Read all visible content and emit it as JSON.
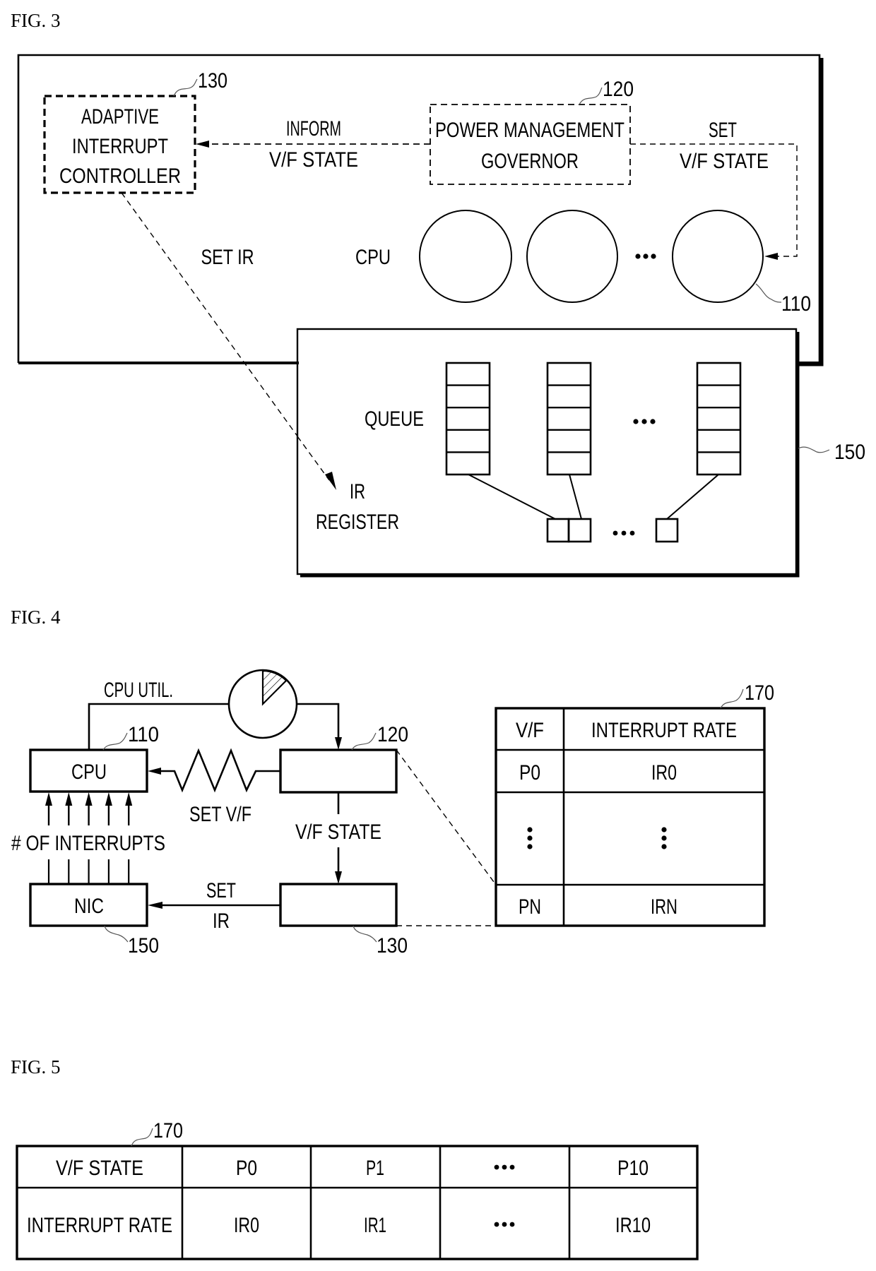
{
  "figures": {
    "fig3": {
      "title": "FIG. 3",
      "adaptive_controller": {
        "lines": [
          "ADAPTIVE",
          "INTERRUPT",
          "CONTROLLER"
        ],
        "ref": "130"
      },
      "governor": {
        "lines": [
          "POWER MANAGEMENT",
          "GOVERNOR"
        ],
        "ref": "120"
      },
      "inform_arrow": {
        "lines": [
          "INFORM",
          "V/F STATE"
        ]
      },
      "set_vf_arrow": {
        "lines": [
          "SET",
          "V/F STATE"
        ]
      },
      "set_ir_label": "SET IR",
      "cpu_label": "CPU",
      "cpu_ellipsis": "•••",
      "cpu_ref": "110",
      "nic": {
        "ref": "150",
        "queue_label": "QUEUE",
        "queue_ellipsis": "•••",
        "register_ellipsis": "•••",
        "ir_register_lines": [
          "IR",
          "REGISTER"
        ],
        "queue_count_shown": 3,
        "cells_per_queue": 5
      }
    },
    "fig4": {
      "title": "FIG. 4",
      "cpu_box": {
        "label": "CPU",
        "ref": "110"
      },
      "nic_box": {
        "label": "NIC",
        "ref": "150"
      },
      "governor_box": {
        "label": "",
        "ref": "120"
      },
      "controller_box": {
        "label": "",
        "ref": "130"
      },
      "cpu_util_label": "CPU UTIL.",
      "cpu_util_fraction": 0.125,
      "set_vf_label": "SET V/F",
      "vf_state_label": "V/F STATE",
      "set_ir_lines": [
        "SET",
        "IR"
      ],
      "interrupts_label": "# OF INTERRUPTS",
      "interrupt_arrow_count": 5,
      "table": {
        "ref": "170",
        "headers": [
          "V/F",
          "INTERRUPT RATE"
        ],
        "rows": [
          [
            "P0",
            "IR0"
          ],
          [
            "⋮",
            "⋮"
          ],
          [
            "PN",
            "IRN"
          ]
        ]
      }
    },
    "fig5": {
      "title": "FIG. 5",
      "table": {
        "ref": "170",
        "rows": [
          [
            "V/F STATE",
            "P0",
            "P1",
            "•••",
            "P10"
          ],
          [
            "INTERRUPT RATE",
            "IR0",
            "IR1",
            "•••",
            "IR10"
          ]
        ]
      }
    }
  }
}
